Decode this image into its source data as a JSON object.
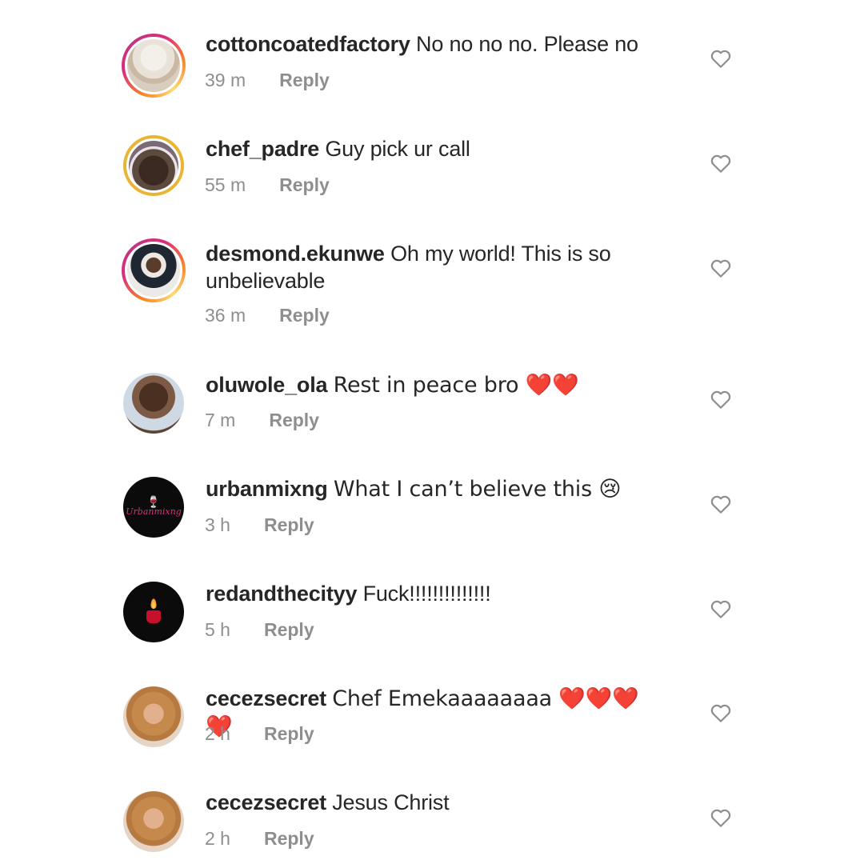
{
  "comments": [
    {
      "username": "cottoncoatedfactory",
      "text": "No no no no. Please no",
      "time": "39 m",
      "reply": "Reply",
      "avatar": "cake-photo",
      "ring": "story"
    },
    {
      "username": "chef_padre",
      "text": "Guy pick ur call",
      "time": "55 m",
      "reply": "Reply",
      "avatar": "man-photo",
      "ring": "gold"
    },
    {
      "username": "desmond.ekunwe",
      "text": "Oh my world! This is so unbelievable",
      "time": "36 m",
      "reply": "Reply",
      "avatar": "man-suit-photo",
      "ring": "story"
    },
    {
      "username": "oluwole_ola",
      "text": "Rest in peace bro ❤️❤️",
      "time": "7 m",
      "reply": "Reply",
      "avatar": "man-photo",
      "ring": "none"
    },
    {
      "username": "urbanmixng",
      "text": "What I can’t believe this 😢",
      "time": "3 h",
      "reply": "Reply",
      "avatar": "urbanmix-logo",
      "ring": "none"
    },
    {
      "username": "redandthecityy",
      "text": "Fuck!!!!!!!!!!!!!!",
      "time": "5 h",
      "reply": "Reply",
      "avatar": "candle-logo",
      "ring": "none"
    },
    {
      "username": "cecezsecret",
      "text": "Chef Emekaaaaaaaa ❤️❤️❤️❤️",
      "time": "2 h",
      "reply": "Reply",
      "avatar": "woman-photo",
      "ring": "none"
    },
    {
      "username": "cecezsecret",
      "text": "Jesus Christ",
      "time": "2 h",
      "reply": "Reply",
      "avatar": "woman-photo",
      "ring": "none"
    }
  ],
  "urbanmix_logo_text": "Urbanmixng",
  "icons": {
    "like": "heart-outline-icon"
  },
  "colors": {
    "text": "#262626",
    "meta": "#8e8e8e",
    "heart": "#8e8e8e",
    "story_ring": "#dd2a7b",
    "gold_ring": "#e8b534"
  }
}
